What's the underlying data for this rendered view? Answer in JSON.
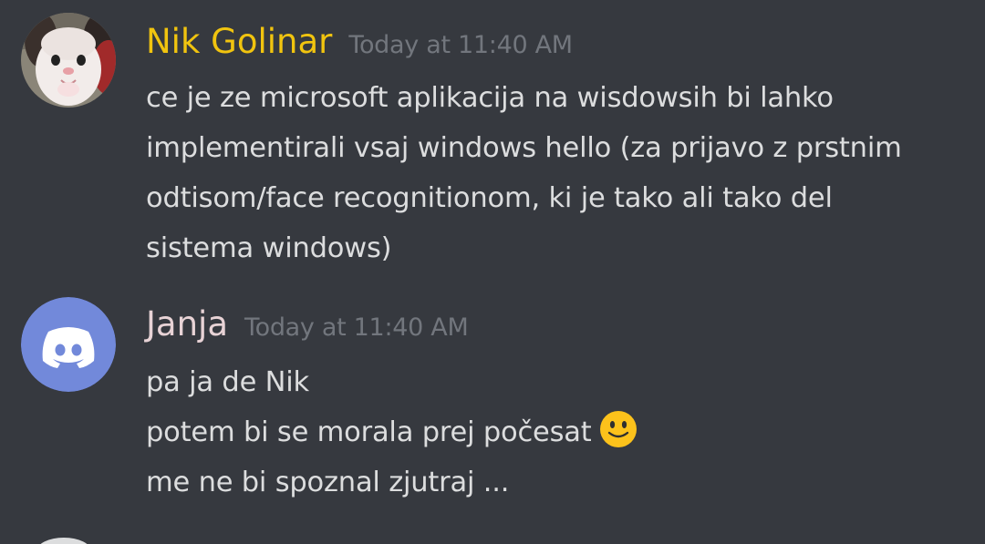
{
  "messages": [
    {
      "author": "Nik Golinar",
      "author_color": "#f1c40f",
      "timestamp": "Today at 11:40 AM",
      "avatar": "cat-photo-avatar",
      "lines": [
        "ce je ze microsoft aplikacija na wisdowsih bi lahko",
        "implementirali vsaj windows hello (za prijavo z prstnim",
        "odtisom/face recognitionom, ki je tako ali tako del",
        "sistema windows)"
      ]
    },
    {
      "author": "Janja",
      "author_color": "#e8d3d6",
      "timestamp": "Today at 11:40 AM",
      "avatar": "discord-default-avatar",
      "avatar_color": "#7289da",
      "lines": [
        "pa ja de Nik",
        "potem bi se morala prej počesat",
        "me ne bi spoznal zjutraj ..."
      ],
      "emoji": "slightly-smiling-face-emoji"
    }
  ],
  "colors": {
    "background": "#36393f",
    "text": "#dcddde",
    "timestamp": "#72767d"
  }
}
